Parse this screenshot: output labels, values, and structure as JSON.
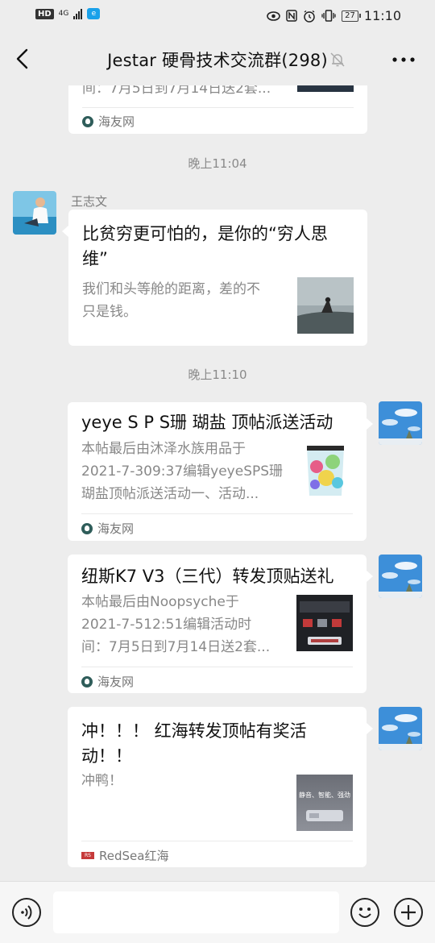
{
  "status_bar": {
    "hd": "HD",
    "network": "4G",
    "battery": "27",
    "time": "11:10"
  },
  "nav": {
    "title": "Jestar 硬骨技术交流群(298)",
    "back_icon": "chevron-left-icon",
    "mute_icon": "bell-off-icon",
    "more_icon": "more-dots-icon"
  },
  "messages": {
    "top_partial": {
      "desc_tail": "间：7月5日到7月14日送2套...",
      "source": "海友网"
    },
    "ts1": "晚上11:04",
    "msg1": {
      "sender": "王志文",
      "title": "比贫穷更可怕的，是你的“穷人思维”",
      "title_line1": "比贫穷更可怕的，是你的“穷人思",
      "title_line2": "维”",
      "desc": "我们和头等舱的距离，差的不只是钱。",
      "desc_line1": "我们和头等舱的距离，差的不",
      "desc_line2": "只是钱。"
    },
    "ts2": "晚上11:10",
    "msg2": {
      "title": "yeye S P S珊 瑚盐 顶帖派送活动",
      "desc_line1": "本帖最后由沐泽水族用品于",
      "desc_line2": "2021-7-309:37编辑yeyeSPS珊",
      "desc_line3": "瑚盐顶帖派送活动一、活动...",
      "source": "海友网"
    },
    "msg3": {
      "title": "纽斯K7 V3（三代）转发顶贴送礼",
      "desc_line1": "本帖最后由Noopsyche于",
      "desc_line2": "2021-7-512:51编辑活动时",
      "desc_line3": "间：7月5日到7月14日送2套...",
      "source": "海友网"
    },
    "msg4": {
      "title_line1": "冲！！！ 红海转发顶帖有奖活",
      "title_line2": "动！！",
      "desc": "冲鸭！",
      "thumb_text": "静音、智能、强劲",
      "source": "RedSea红海"
    }
  },
  "input_bar": {
    "voice_icon": "voice-icon",
    "emoji_icon": "emoji-icon",
    "plus_icon": "plus-icon"
  },
  "colors": {
    "background": "#ededed",
    "bubble": "#ffffff",
    "muted_text": "#888888"
  }
}
